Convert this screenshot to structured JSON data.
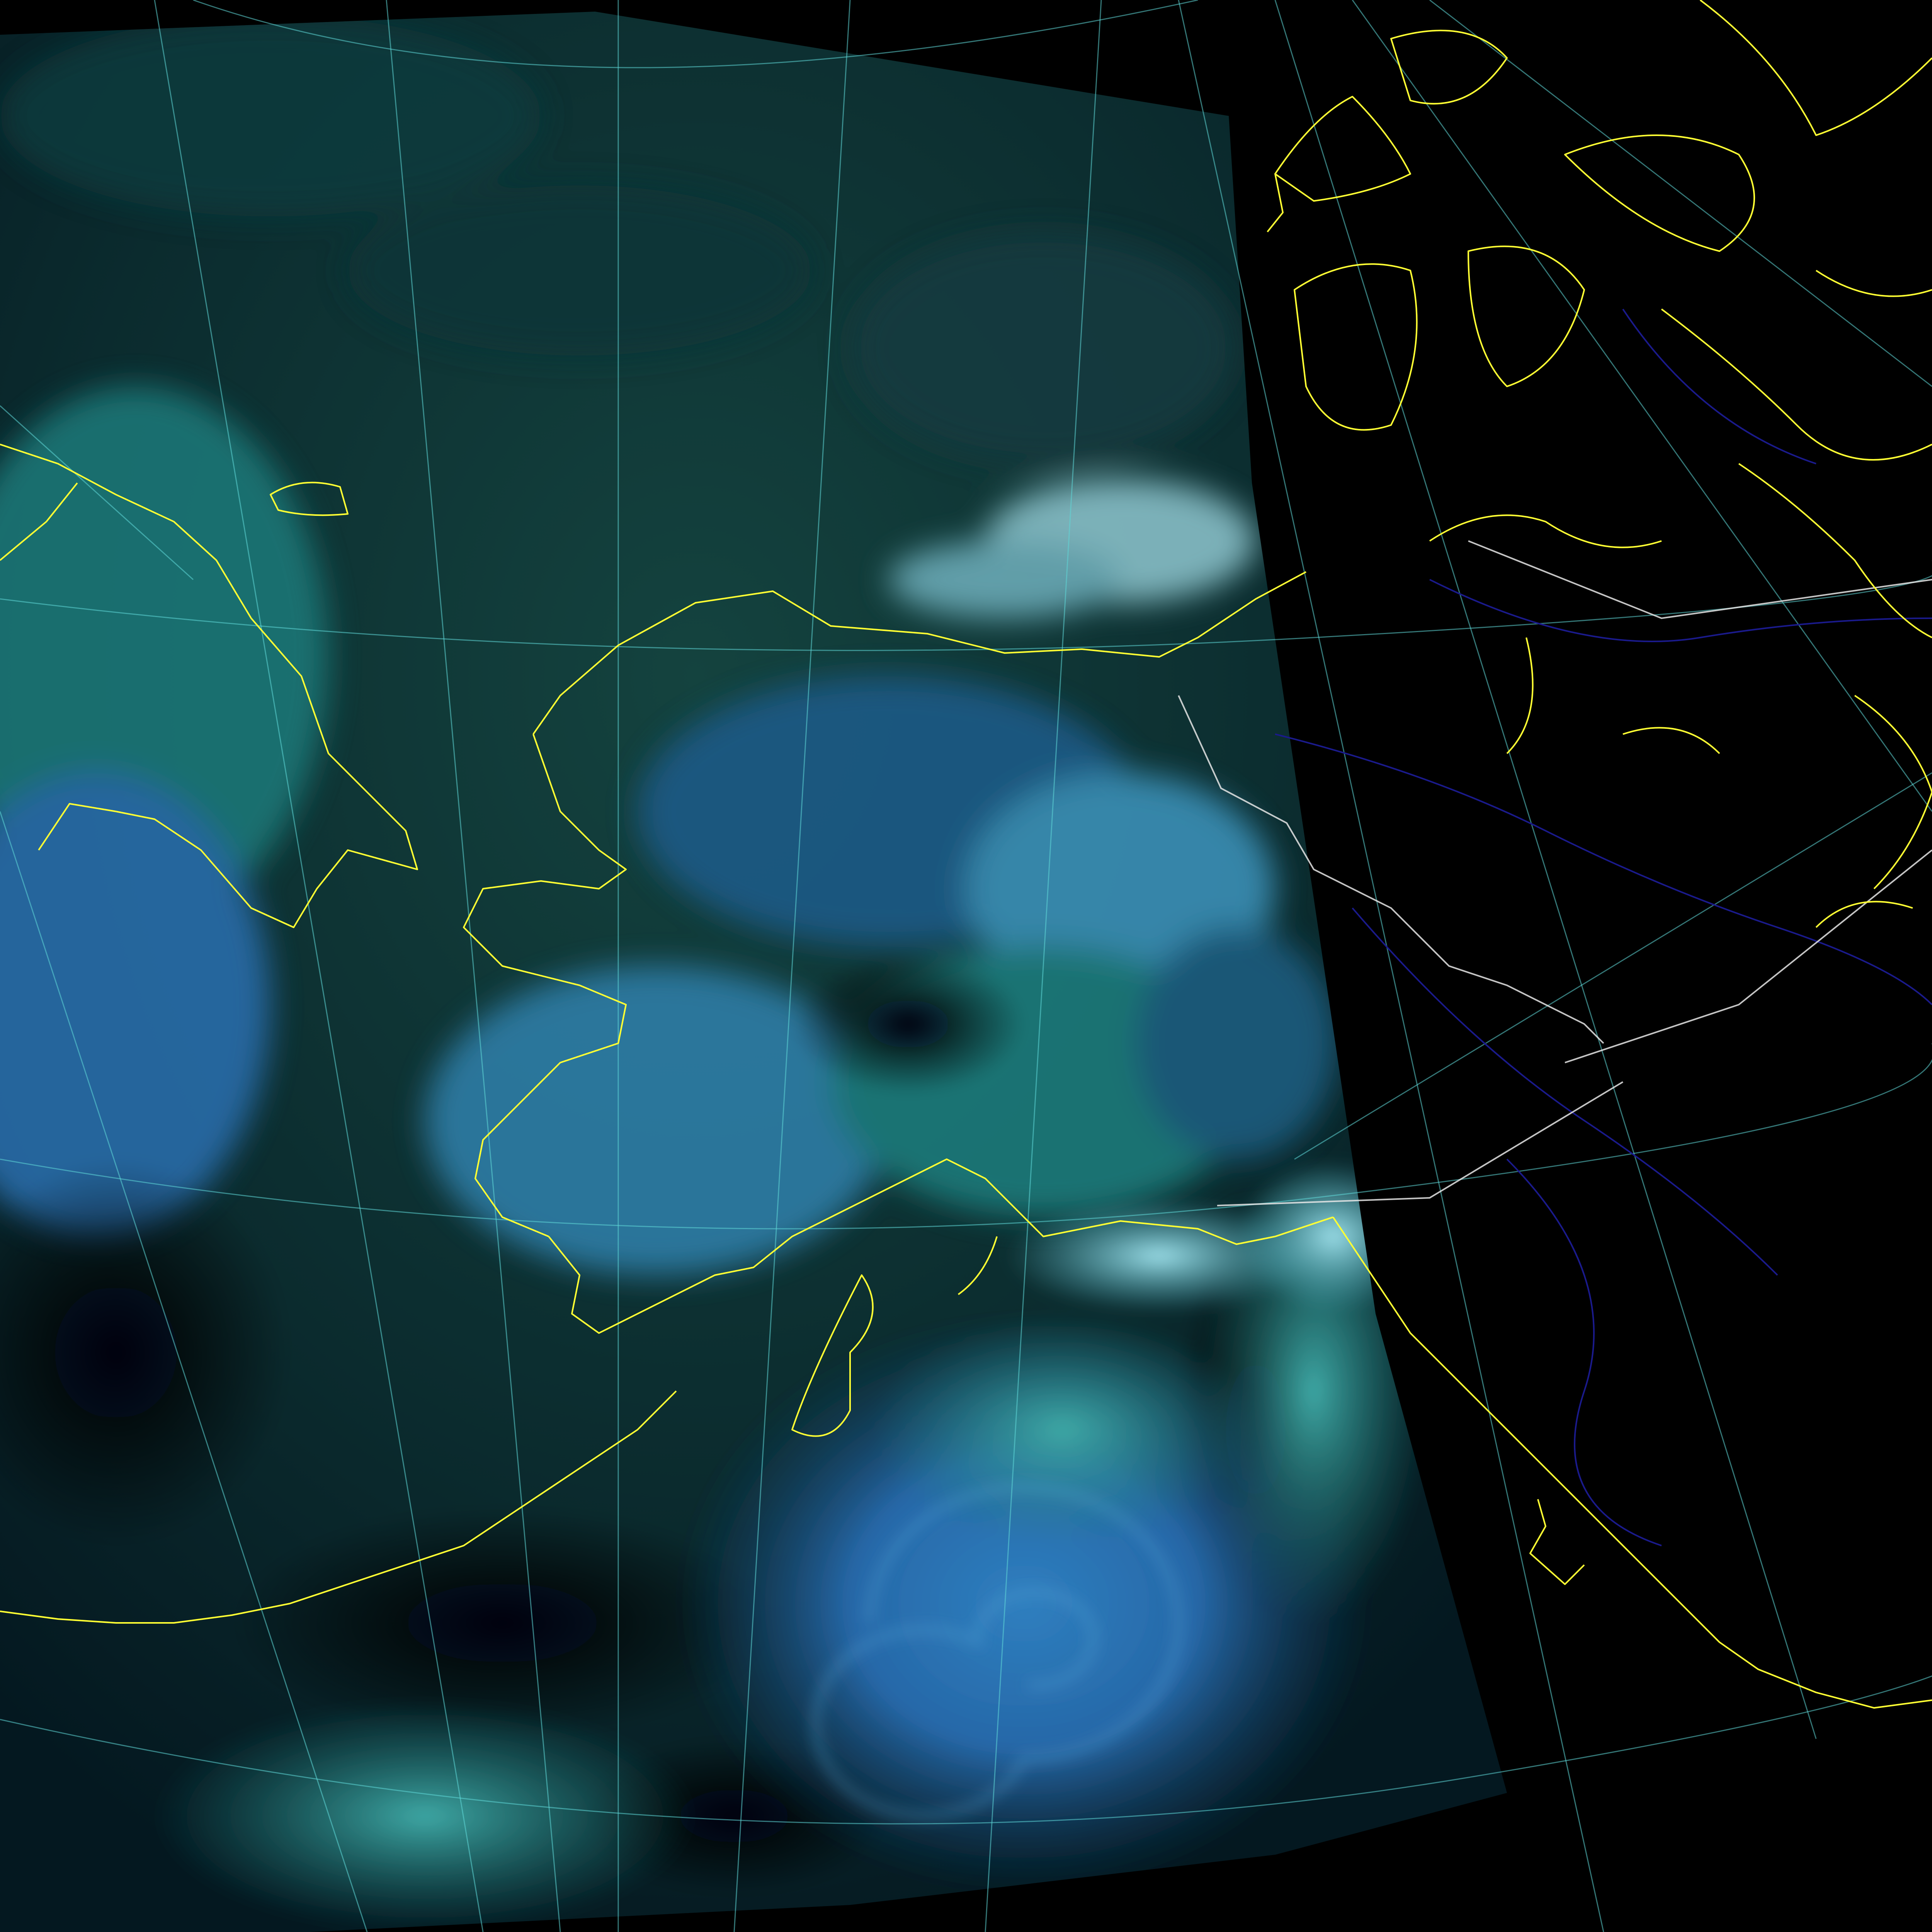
{
  "image": {
    "kind": "satellite-composite",
    "background_color": "#000000",
    "swath_colors": {
      "ocean_dark": "#041820",
      "ice_teal": "#1f7a7a",
      "cloud_blue": "#2a6fb0",
      "cloud_bright": "#7fd6e0",
      "deep_black": "#02060a"
    },
    "overlay_colors": {
      "coastline": "#ffff33",
      "graticule": "#5fd7d7",
      "political_border": "#e6e6e6",
      "rivers": "#1a1a8c"
    },
    "features": {
      "coastlines": true,
      "graticule": true,
      "political_borders": true,
      "rivers": true
    }
  }
}
